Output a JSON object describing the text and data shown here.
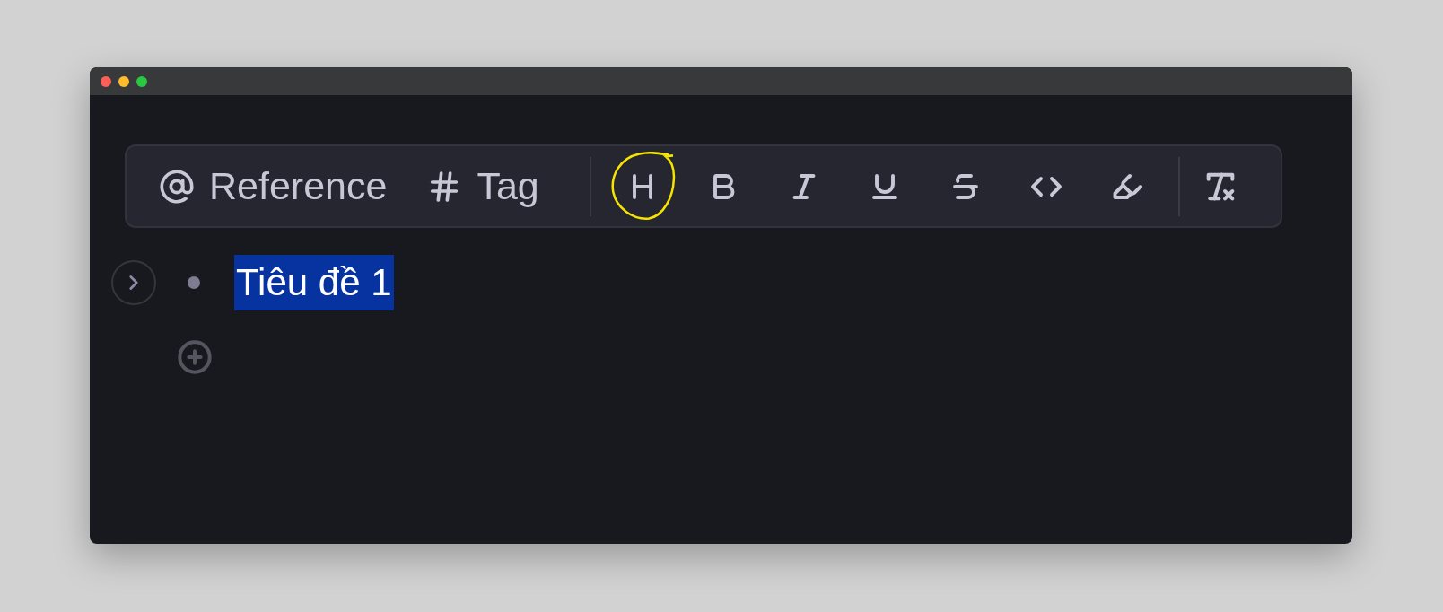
{
  "window": {
    "controls": [
      {
        "color": "#fe5f57"
      },
      {
        "color": "#febc2e"
      },
      {
        "color": "#28c840"
      }
    ]
  },
  "toolbar": {
    "insert_buttons": [
      {
        "kind": "reference",
        "label": "Reference"
      },
      {
        "kind": "tag",
        "label": "Tag"
      }
    ],
    "format_buttons": [
      {
        "kind": "heading",
        "circled": true
      },
      {
        "kind": "bold",
        "circled": false
      },
      {
        "kind": "italic",
        "circled": false
      },
      {
        "kind": "underline",
        "circled": false
      },
      {
        "kind": "strikethrough",
        "circled": false
      },
      {
        "kind": "code",
        "circled": false
      },
      {
        "kind": "highlight",
        "circled": false
      }
    ],
    "clear_button": {
      "kind": "clear-format"
    }
  },
  "blocks": [
    {
      "text": "Tiêu đề 1",
      "selected": true,
      "collapsed": true
    }
  ]
}
